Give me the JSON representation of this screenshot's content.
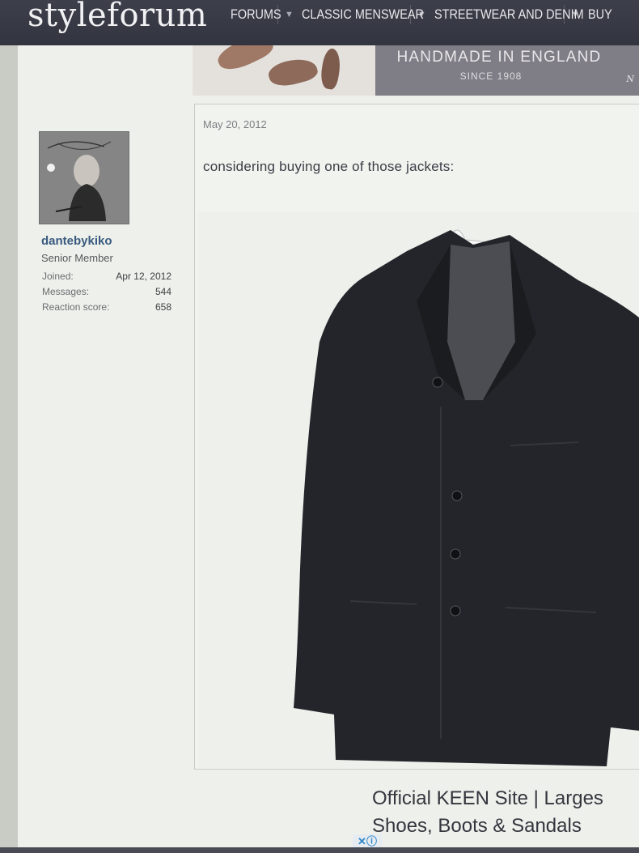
{
  "site": {
    "logo": "styleforum"
  },
  "nav": [
    {
      "label": "FORUMS"
    },
    {
      "label": "CLASSIC MENSWEAR"
    },
    {
      "label": "STREETWEAR AND DENIM"
    },
    {
      "label": "BUY"
    }
  ],
  "banner": {
    "title": "HANDMADE IN ENGLAND",
    "subtitle": "SINCE 1908",
    "mark": "N"
  },
  "post": {
    "author": {
      "username": "dantebykiko",
      "title": "Senior Member",
      "stats": [
        {
          "label": "Joined:",
          "value": "Apr 12, 2012"
        },
        {
          "label": "Messages:",
          "value": "544"
        },
        {
          "label": "Reaction score:",
          "value": "658"
        }
      ]
    },
    "date": "May 20, 2012",
    "text": "considering buying one of those jackets:"
  },
  "ad": {
    "line1": "Official KEEN Site | Larges",
    "line2": "Shoes, Boots & Sandals",
    "icons": "✕ⓘ"
  },
  "colors": {
    "topbar": "#373945",
    "username": "#395a7e",
    "jacket": "#23252a"
  }
}
